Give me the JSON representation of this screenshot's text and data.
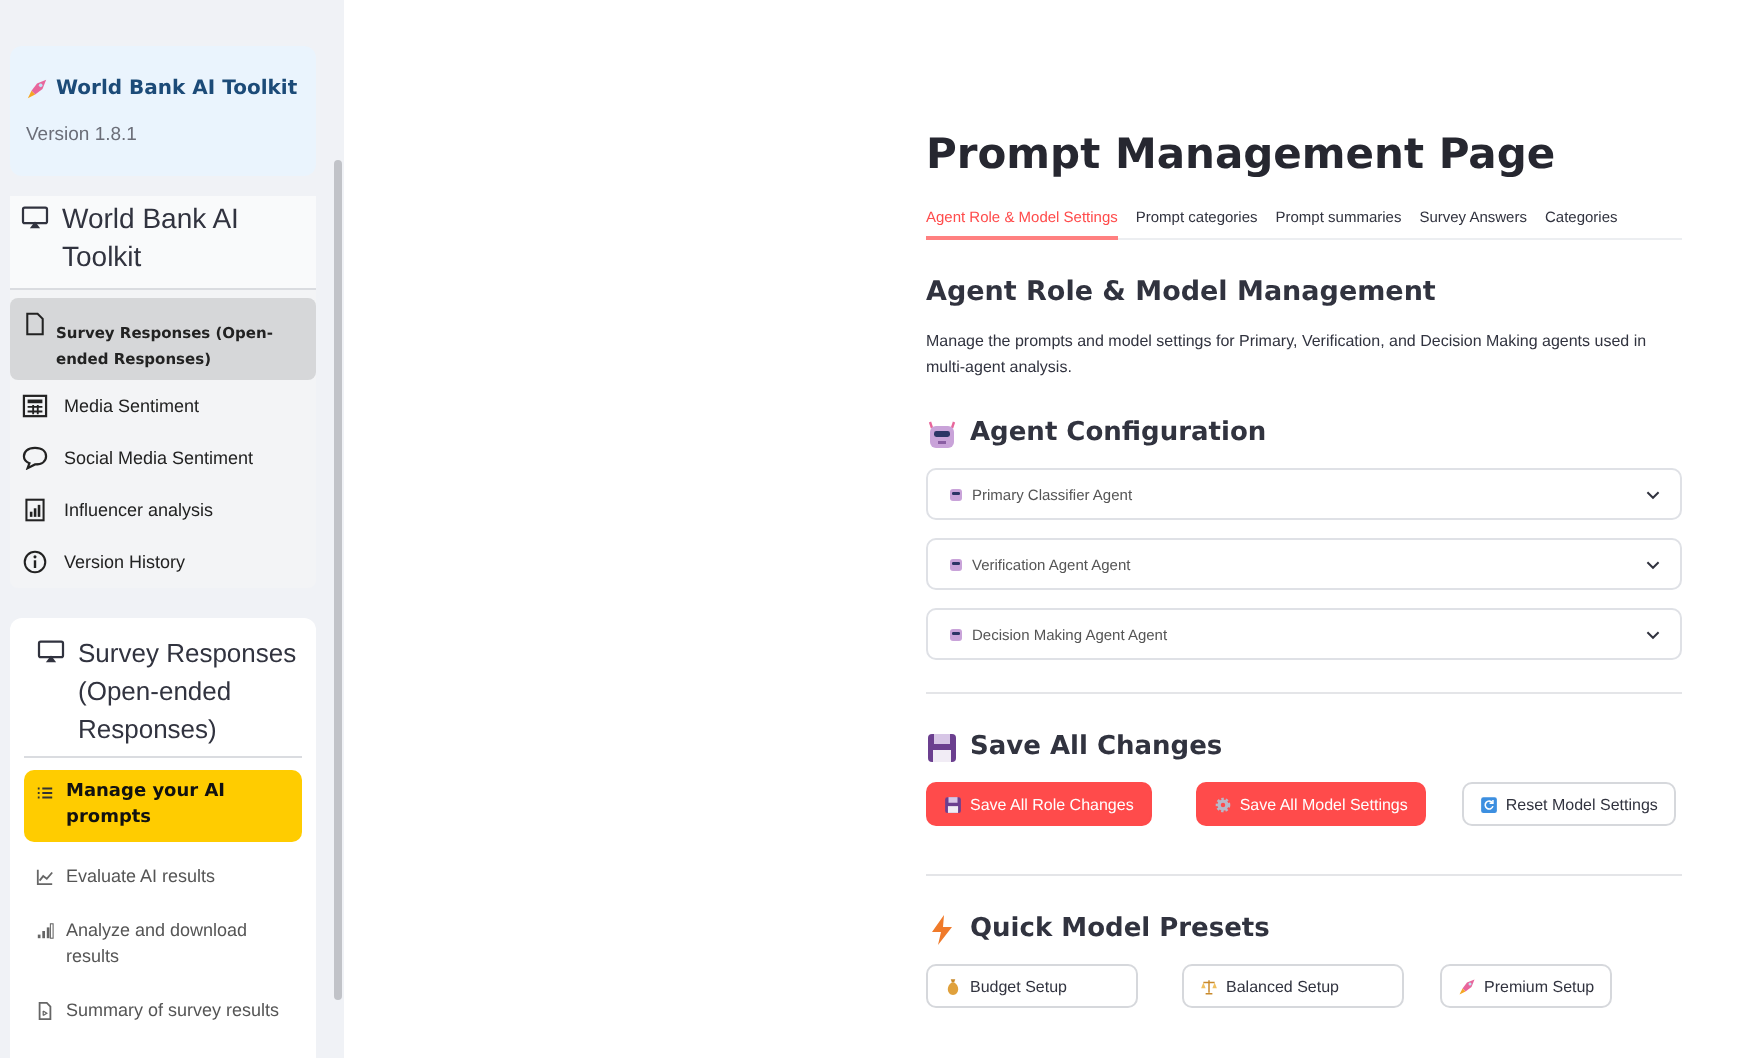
{
  "sidebar": {
    "brand": {
      "title": "World Bank AI Toolkit",
      "version": "Version 1.8.1"
    },
    "nav": {
      "title": "World Bank AI Toolkit",
      "items": [
        {
          "label": "Survey Responses (Open-ended Responses)",
          "selected": true
        },
        {
          "label": "Media Sentiment",
          "selected": false
        },
        {
          "label": "Social Media Sentiment",
          "selected": false
        },
        {
          "label": "Influencer analysis",
          "selected": false
        },
        {
          "label": "Version History",
          "selected": false
        }
      ]
    },
    "subnav": {
      "title": "Survey Responses (Open-ended Responses)",
      "items": [
        {
          "label": "Manage your AI prompts",
          "selected": true
        },
        {
          "label": "Evaluate AI results",
          "selected": false
        },
        {
          "label": "Analyze and download results",
          "selected": false
        },
        {
          "label": "Summary of survey results",
          "selected": false
        }
      ]
    }
  },
  "main": {
    "title": "Prompt Management Page",
    "tabs": [
      {
        "label": "Agent Role & Model Settings",
        "selected": true
      },
      {
        "label": "Prompt categories",
        "selected": false
      },
      {
        "label": "Prompt summaries",
        "selected": false
      },
      {
        "label": "Survey Answers",
        "selected": false
      },
      {
        "label": "Categories",
        "selected": false
      }
    ],
    "heading": "Agent Role & Model Management",
    "description": "Manage the prompts and model settings for Primary, Verification, and Decision Making agents used in multi-agent analysis.",
    "agent_configuration": {
      "heading": "Agent Configuration",
      "agents": [
        {
          "label": "Primary Classifier Agent",
          "expanded": false
        },
        {
          "label": "Verification Agent Agent",
          "expanded": false
        },
        {
          "label": "Decision Making Agent Agent",
          "expanded": false
        }
      ]
    },
    "save": {
      "heading": "Save All Changes",
      "buttons": [
        {
          "label": "Save All Role Changes",
          "kind": "primary"
        },
        {
          "label": "Save All Model Settings",
          "kind": "primary"
        },
        {
          "label": "Reset Model Settings",
          "kind": "secondary"
        }
      ]
    },
    "presets": {
      "heading": "Quick Model Presets",
      "buttons": [
        {
          "label": "Budget Setup",
          "kind": "secondary"
        },
        {
          "label": "Balanced Setup",
          "kind": "secondary"
        },
        {
          "label": "Premium Setup",
          "kind": "secondary"
        }
      ]
    }
  }
}
